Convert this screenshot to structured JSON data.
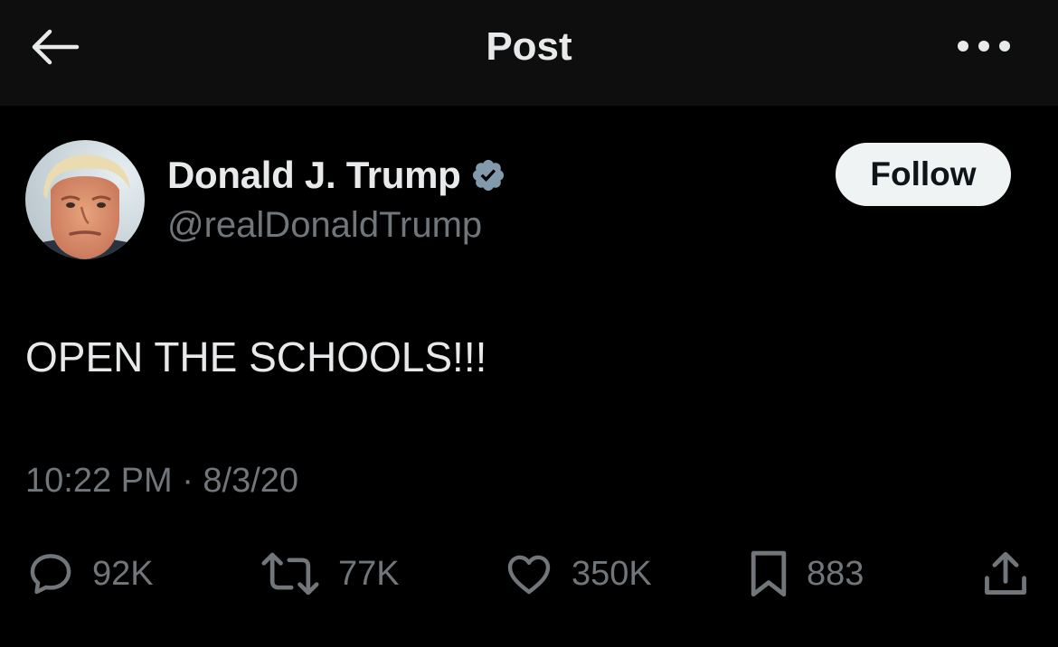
{
  "header": {
    "title": "Post",
    "back_icon": "arrow-left-icon",
    "more_icon": "more-horizontal-icon"
  },
  "author": {
    "display_name": "Donald J. Trump",
    "handle": "@realDonaldTrump",
    "verified": true,
    "verified_icon": "verified-badge-icon",
    "follow_label": "Follow"
  },
  "tweet": {
    "text": "OPEN THE SCHOOLS!!!",
    "timestamp": "10:22 PM · 8/3/20"
  },
  "actions": {
    "replies": "92K",
    "reposts": "77K",
    "likes": "350K",
    "bookmarks": "883"
  },
  "colors": {
    "background": "#000000",
    "header_background": "#0e0e0e",
    "primary_text": "#e7e9ea",
    "secondary_text": "#71767b",
    "follow_button_bg": "#eff3f4",
    "verified_badge": "#829aab"
  }
}
